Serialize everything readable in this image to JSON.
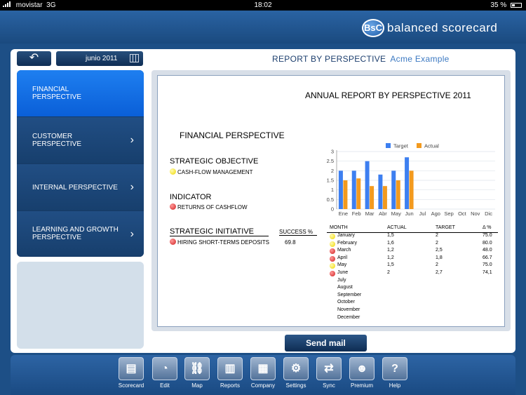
{
  "status_bar": {
    "carrier": "movistar",
    "network": "3G",
    "time": "18:02",
    "battery": "35 %"
  },
  "header": {
    "logo_text": "BsC",
    "brand": "balanced scorecard"
  },
  "controls": {
    "back_symbol": "↶",
    "date": "junio 2011"
  },
  "report_header": {
    "title": "REPORT BY PERSPECTIVE",
    "company": "Acme Example"
  },
  "sidebar": {
    "items": [
      {
        "label": "FINANCIAL PERSPECTIVE",
        "active": true
      },
      {
        "label": "CUSTOMER PERSPECTIVE",
        "chevron": "›"
      },
      {
        "label": "INTERNAL PERSPECTIVE",
        "chevron": "›"
      },
      {
        "label": "LEARNING AND GROWTH PERSPECTIVE",
        "chevron": "›"
      }
    ]
  },
  "report": {
    "annual_title": "ANNUAL REPORT BY PERSPECTIVE 2011",
    "perspective": "FINANCIAL PERSPECTIVE",
    "strategic_objective_label": "STRATEGIC OBJECTIVE",
    "strategic_objective": "CASH-FLOW MANAGEMENT",
    "indicator_label": "INDICATOR",
    "indicator": "RETURNS OF CASHFLOW",
    "initiative_label": "STRATEGIC INITIATIVE",
    "success_label": "SUCCESS %",
    "initiative": "HIRING SHORT-TERMS DEPOSITS",
    "initiative_success": "69.8",
    "table_headers": {
      "month": "MONTH",
      "actual": "ACTUAL",
      "target": "TARGET",
      "delta": "Δ %"
    },
    "table_rows": [
      {
        "month": "January",
        "actual": "1,5",
        "target": "2",
        "delta": "75.0",
        "status": "yellow"
      },
      {
        "month": "February",
        "actual": "1,6",
        "target": "2",
        "delta": "80.0",
        "status": "yellow"
      },
      {
        "month": "March",
        "actual": "1,2",
        "target": "2,5",
        "delta": "48.0",
        "status": "red"
      },
      {
        "month": "April",
        "actual": "1,2",
        "target": "1,8",
        "delta": "66.7",
        "status": "red"
      },
      {
        "month": "May",
        "actual": "1,5",
        "target": "2",
        "delta": "75.0",
        "status": "yellow"
      },
      {
        "month": "June",
        "actual": "2",
        "target": "2,7",
        "delta": "74,1",
        "status": "red"
      },
      {
        "month": "July",
        "actual": "",
        "target": "",
        "delta": "",
        "status": ""
      },
      {
        "month": "August",
        "actual": "",
        "target": "",
        "delta": "",
        "status": ""
      },
      {
        "month": "September",
        "actual": "",
        "target": "",
        "delta": "",
        "status": ""
      },
      {
        "month": "October",
        "actual": "",
        "target": "",
        "delta": "",
        "status": ""
      },
      {
        "month": "November",
        "actual": "",
        "target": "",
        "delta": "",
        "status": ""
      },
      {
        "month": "December",
        "actual": "",
        "target": "",
        "delta": "",
        "status": ""
      }
    ]
  },
  "chart_data": {
    "type": "bar",
    "categories": [
      "Ene",
      "Feb",
      "Mar",
      "Abr",
      "May",
      "Jun",
      "Jul",
      "Ago",
      "Sep",
      "Oct",
      "Nov",
      "Dic"
    ],
    "series": [
      {
        "name": "Target",
        "color": "#3d7ff0",
        "values": [
          2,
          2,
          2.5,
          1.8,
          2,
          2.7,
          null,
          null,
          null,
          null,
          null,
          null
        ]
      },
      {
        "name": "Actual",
        "color": "#f39a1e",
        "values": [
          1.5,
          1.6,
          1.2,
          1.2,
          1.5,
          2,
          null,
          null,
          null,
          null,
          null,
          null
        ]
      }
    ],
    "yticks": [
      "0",
      "0.5",
      "1",
      "1.5",
      "2",
      "2.5",
      "3"
    ],
    "ylim": [
      0,
      3
    ],
    "legend": "top",
    "grid": true
  },
  "actions": {
    "send_mail": "Send mail"
  },
  "toolbar": [
    {
      "label": "Scorecard",
      "icon": "scorecard-icon",
      "glyph": "▤"
    },
    {
      "label": "Edit",
      "icon": "gauge-icon",
      "glyph": "◔"
    },
    {
      "label": "Map",
      "icon": "map-link-icon",
      "glyph": "⛓"
    },
    {
      "label": "Reports",
      "icon": "reports-icon",
      "glyph": "▥"
    },
    {
      "label": "Company",
      "icon": "company-icon",
      "glyph": "▦"
    },
    {
      "label": "Settings",
      "icon": "gear-icon",
      "glyph": "⚙"
    },
    {
      "label": "Sync",
      "icon": "sync-icon",
      "glyph": "⇄"
    },
    {
      "label": "Premium",
      "icon": "user-icon",
      "glyph": "☻"
    },
    {
      "label": "Help",
      "icon": "help-icon",
      "glyph": "?"
    }
  ]
}
